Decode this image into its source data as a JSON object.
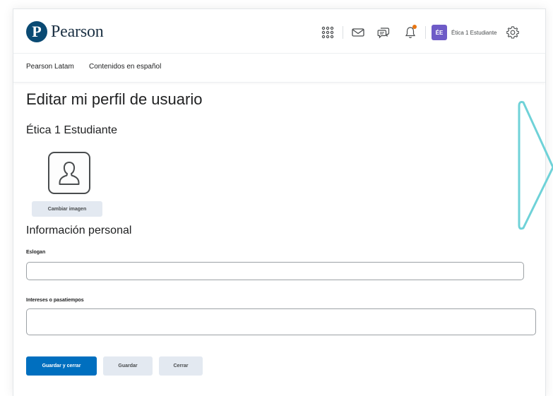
{
  "header": {
    "logo_letter": "P",
    "logo_text": "Pearson",
    "user_initials": "ÉE",
    "user_name": "Ética 1 Estudiante",
    "icons": [
      "apps-grid-icon",
      "mail-icon",
      "chat-icon",
      "bell-icon",
      "gear-icon"
    ],
    "notification_dot_color": "#e87511"
  },
  "nav": {
    "items": [
      {
        "label": "Pearson Latam"
      },
      {
        "label": "Contenidos en español"
      }
    ]
  },
  "page": {
    "title": "Editar mi perfil de usuario",
    "user_heading": "Ética 1 Estudiante",
    "change_image_label": "Cambiar imagen",
    "section_title": "Información personal"
  },
  "form": {
    "slogan": {
      "label": "Eslogan",
      "value": ""
    },
    "interests": {
      "label": "Intereses o pasatiempos",
      "value": ""
    }
  },
  "buttons": {
    "save_close": "Guardar y cerrar",
    "save": "Guardar",
    "close": "Cerrar"
  },
  "colors": {
    "primary": "#006fbf",
    "secondary": "#e3e9f1",
    "avatar": "#6e5bc7",
    "brand": "#0a4a73",
    "decoration": "#6fd2d8"
  }
}
